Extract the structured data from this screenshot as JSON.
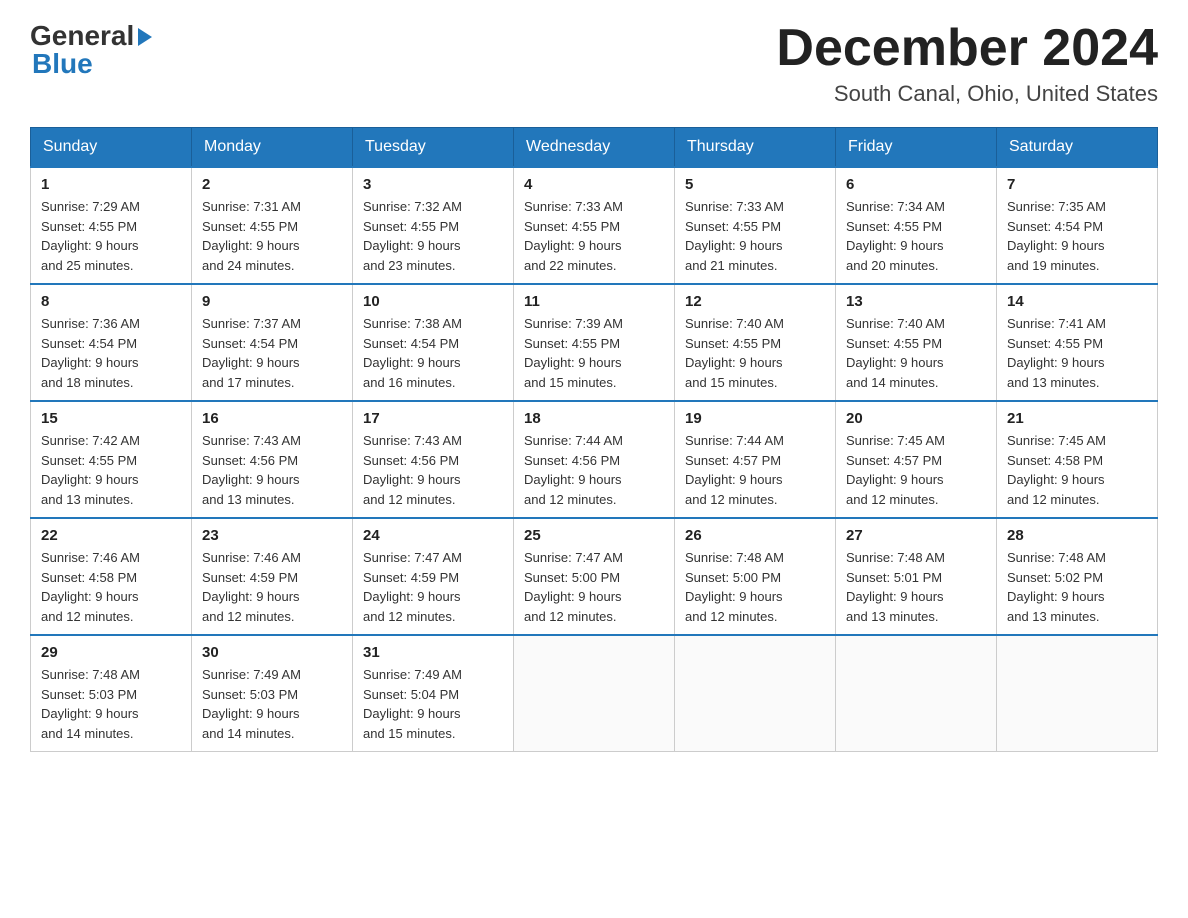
{
  "header": {
    "logo_general": "General",
    "logo_blue": "Blue",
    "title": "December 2024",
    "subtitle": "South Canal, Ohio, United States"
  },
  "days_of_week": [
    "Sunday",
    "Monday",
    "Tuesday",
    "Wednesday",
    "Thursday",
    "Friday",
    "Saturday"
  ],
  "weeks": [
    [
      {
        "day": "1",
        "sunrise": "7:29 AM",
        "sunset": "4:55 PM",
        "daylight": "9 hours and 25 minutes."
      },
      {
        "day": "2",
        "sunrise": "7:31 AM",
        "sunset": "4:55 PM",
        "daylight": "9 hours and 24 minutes."
      },
      {
        "day": "3",
        "sunrise": "7:32 AM",
        "sunset": "4:55 PM",
        "daylight": "9 hours and 23 minutes."
      },
      {
        "day": "4",
        "sunrise": "7:33 AM",
        "sunset": "4:55 PM",
        "daylight": "9 hours and 22 minutes."
      },
      {
        "day": "5",
        "sunrise": "7:33 AM",
        "sunset": "4:55 PM",
        "daylight": "9 hours and 21 minutes."
      },
      {
        "day": "6",
        "sunrise": "7:34 AM",
        "sunset": "4:55 PM",
        "daylight": "9 hours and 20 minutes."
      },
      {
        "day": "7",
        "sunrise": "7:35 AM",
        "sunset": "4:54 PM",
        "daylight": "9 hours and 19 minutes."
      }
    ],
    [
      {
        "day": "8",
        "sunrise": "7:36 AM",
        "sunset": "4:54 PM",
        "daylight": "9 hours and 18 minutes."
      },
      {
        "day": "9",
        "sunrise": "7:37 AM",
        "sunset": "4:54 PM",
        "daylight": "9 hours and 17 minutes."
      },
      {
        "day": "10",
        "sunrise": "7:38 AM",
        "sunset": "4:54 PM",
        "daylight": "9 hours and 16 minutes."
      },
      {
        "day": "11",
        "sunrise": "7:39 AM",
        "sunset": "4:55 PM",
        "daylight": "9 hours and 15 minutes."
      },
      {
        "day": "12",
        "sunrise": "7:40 AM",
        "sunset": "4:55 PM",
        "daylight": "9 hours and 15 minutes."
      },
      {
        "day": "13",
        "sunrise": "7:40 AM",
        "sunset": "4:55 PM",
        "daylight": "9 hours and 14 minutes."
      },
      {
        "day": "14",
        "sunrise": "7:41 AM",
        "sunset": "4:55 PM",
        "daylight": "9 hours and 13 minutes."
      }
    ],
    [
      {
        "day": "15",
        "sunrise": "7:42 AM",
        "sunset": "4:55 PM",
        "daylight": "9 hours and 13 minutes."
      },
      {
        "day": "16",
        "sunrise": "7:43 AM",
        "sunset": "4:56 PM",
        "daylight": "9 hours and 13 minutes."
      },
      {
        "day": "17",
        "sunrise": "7:43 AM",
        "sunset": "4:56 PM",
        "daylight": "9 hours and 12 minutes."
      },
      {
        "day": "18",
        "sunrise": "7:44 AM",
        "sunset": "4:56 PM",
        "daylight": "9 hours and 12 minutes."
      },
      {
        "day": "19",
        "sunrise": "7:44 AM",
        "sunset": "4:57 PM",
        "daylight": "9 hours and 12 minutes."
      },
      {
        "day": "20",
        "sunrise": "7:45 AM",
        "sunset": "4:57 PM",
        "daylight": "9 hours and 12 minutes."
      },
      {
        "day": "21",
        "sunrise": "7:45 AM",
        "sunset": "4:58 PM",
        "daylight": "9 hours and 12 minutes."
      }
    ],
    [
      {
        "day": "22",
        "sunrise": "7:46 AM",
        "sunset": "4:58 PM",
        "daylight": "9 hours and 12 minutes."
      },
      {
        "day": "23",
        "sunrise": "7:46 AM",
        "sunset": "4:59 PM",
        "daylight": "9 hours and 12 minutes."
      },
      {
        "day": "24",
        "sunrise": "7:47 AM",
        "sunset": "4:59 PM",
        "daylight": "9 hours and 12 minutes."
      },
      {
        "day": "25",
        "sunrise": "7:47 AM",
        "sunset": "5:00 PM",
        "daylight": "9 hours and 12 minutes."
      },
      {
        "day": "26",
        "sunrise": "7:48 AM",
        "sunset": "5:00 PM",
        "daylight": "9 hours and 12 minutes."
      },
      {
        "day": "27",
        "sunrise": "7:48 AM",
        "sunset": "5:01 PM",
        "daylight": "9 hours and 13 minutes."
      },
      {
        "day": "28",
        "sunrise": "7:48 AM",
        "sunset": "5:02 PM",
        "daylight": "9 hours and 13 minutes."
      }
    ],
    [
      {
        "day": "29",
        "sunrise": "7:48 AM",
        "sunset": "5:03 PM",
        "daylight": "9 hours and 14 minutes."
      },
      {
        "day": "30",
        "sunrise": "7:49 AM",
        "sunset": "5:03 PM",
        "daylight": "9 hours and 14 minutes."
      },
      {
        "day": "31",
        "sunrise": "7:49 AM",
        "sunset": "5:04 PM",
        "daylight": "9 hours and 15 minutes."
      },
      null,
      null,
      null,
      null
    ]
  ],
  "labels": {
    "sunrise": "Sunrise:",
    "sunset": "Sunset:",
    "daylight": "Daylight:"
  }
}
